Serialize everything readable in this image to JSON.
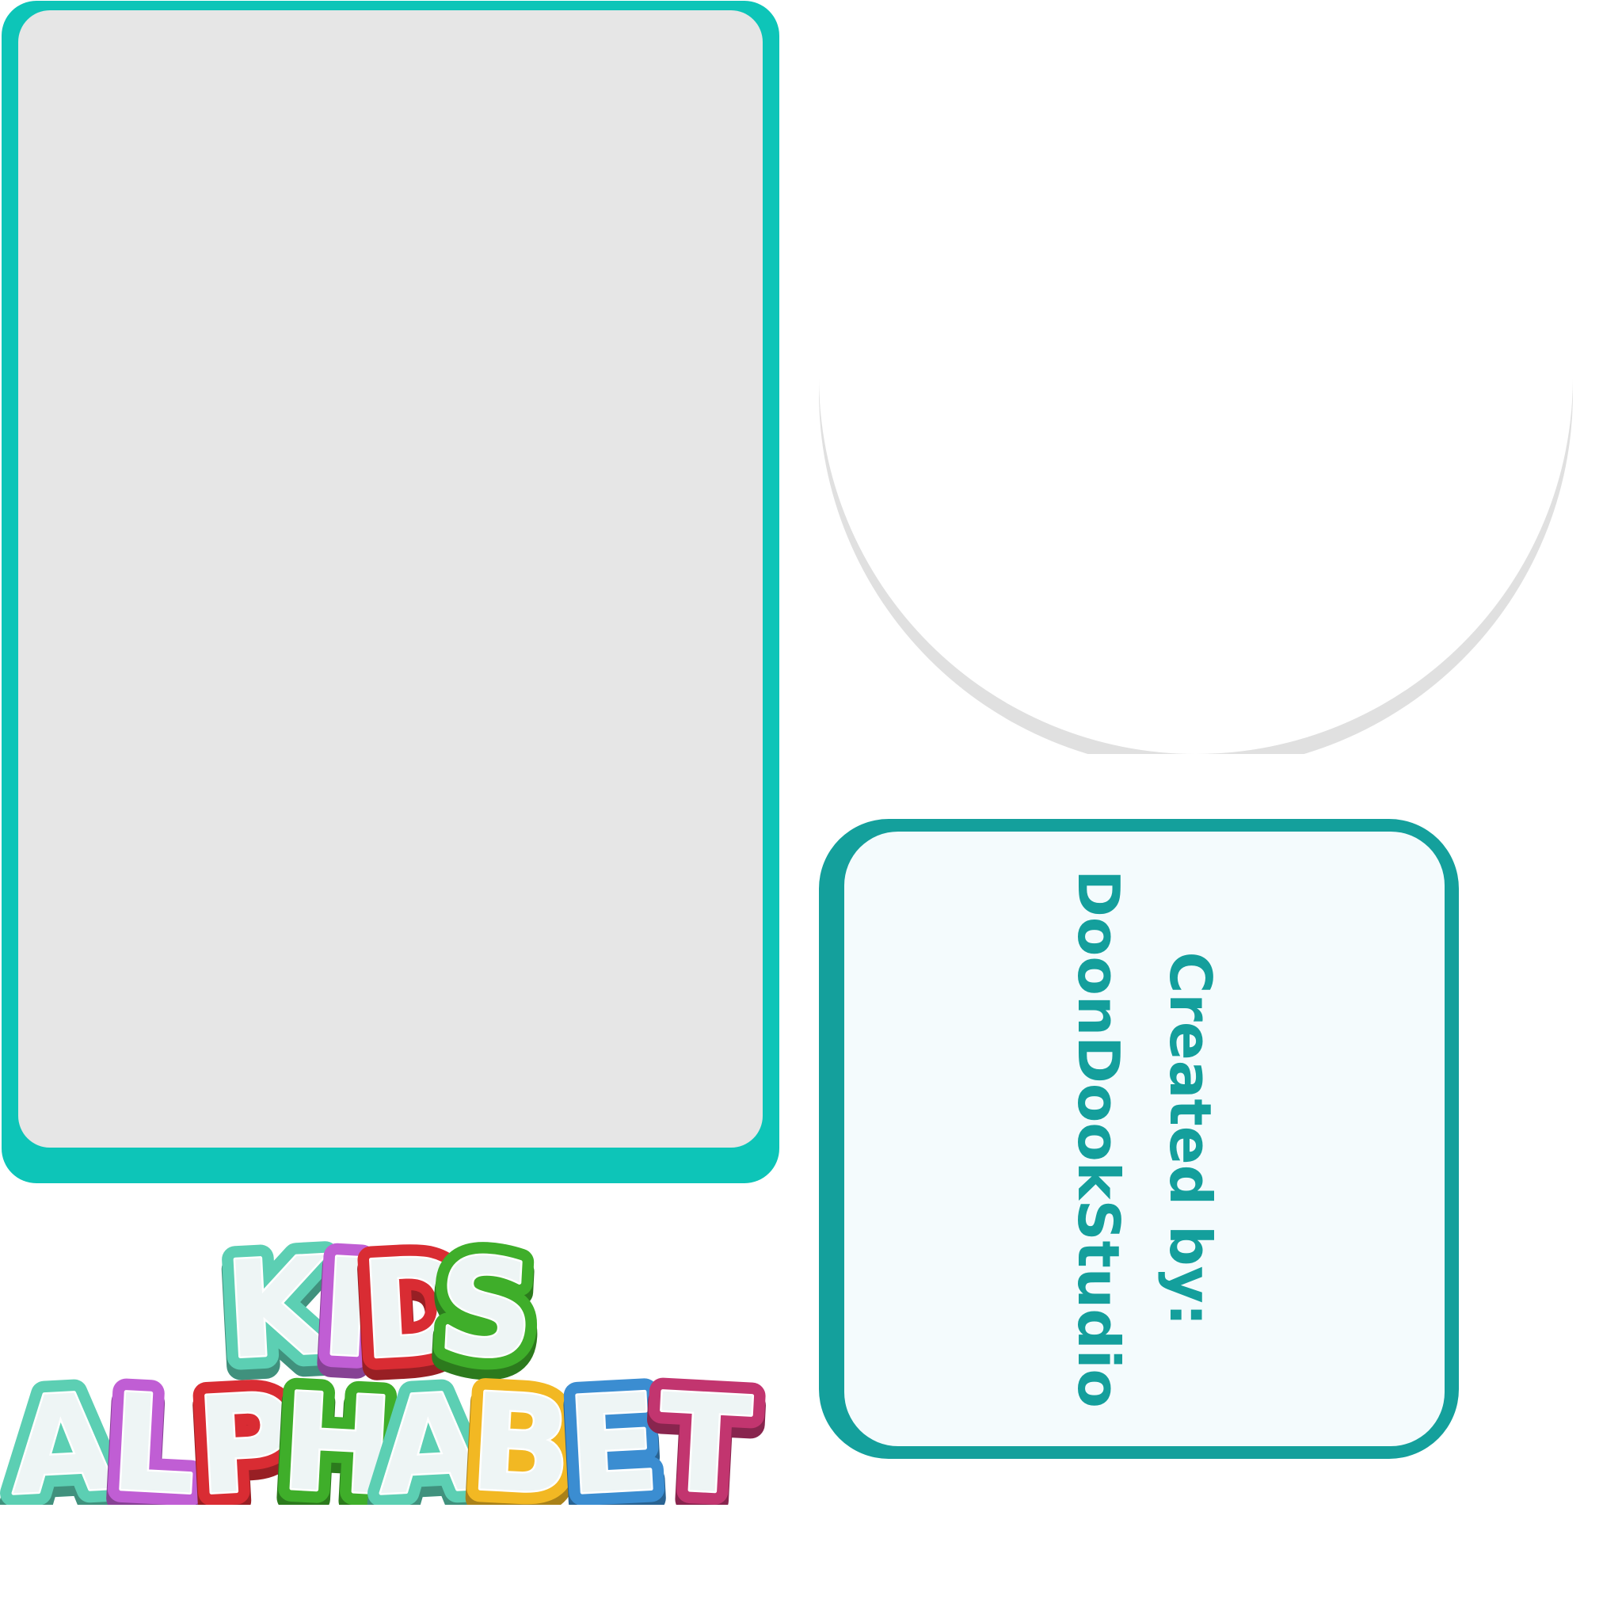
{
  "credits": {
    "line1": "Created by:",
    "line2": "DoonDookStudio"
  },
  "logo": {
    "row1": [
      "K",
      "I",
      "D",
      "S"
    ],
    "row2": [
      "A",
      "L",
      "P",
      "H",
      "A",
      "B",
      "E",
      "T"
    ],
    "row1_colors": [
      "#5ccfb3",
      "#c05ed4",
      "#d92c33",
      "#3fae2a"
    ],
    "row2_colors": [
      "#5ccfb3",
      "#c05ed4",
      "#d92c33",
      "#3fae2a",
      "#5ccfb3",
      "#f2b823",
      "#3b8dd1",
      "#c2356f"
    ]
  },
  "colors": {
    "card_frame": "#0dc5b8",
    "card_fill": "#e6e6e6",
    "credits_frame": "#14a09c",
    "credits_fill": "#f4fbfd",
    "credits_text": "#149f9c",
    "circle_shadow": "#e0e0e0",
    "letter_face": "#eef5f5"
  }
}
